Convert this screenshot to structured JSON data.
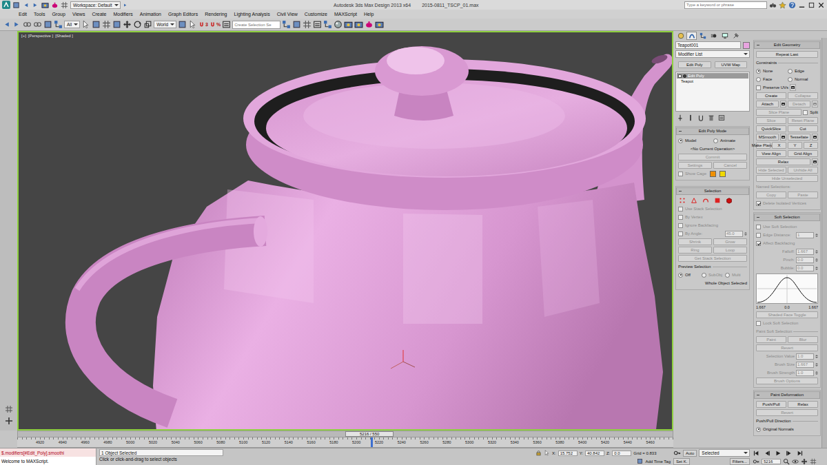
{
  "title_bar": {
    "workspace": "Workspace: Default",
    "title": "Autodesk 3ds Max Design 2013 x64",
    "file": "2015-0811_TSCP_01.max",
    "search": {
      "placeholder": "Type a keyword or phrase"
    }
  },
  "menu": [
    "Edit",
    "Tools",
    "Group",
    "Views",
    "Create",
    "Modifiers",
    "Animation",
    "Graph Editors",
    "Rendering",
    "Lighting Analysis",
    "Civil View",
    "Customize",
    "MAXScript",
    "Help"
  ],
  "toolbar": {
    "selection_filter": "All",
    "reference_coord": "World",
    "snaps": [
      "3",
      "%"
    ],
    "named_selection": {
      "placeholder": "Create Selection Se"
    }
  },
  "viewport": {
    "labels": [
      "[+]",
      "[Perspective ]",
      "[Shaded ]"
    ],
    "active": true
  },
  "command_panel": {
    "tabs": [
      {
        "selected": false
      },
      {
        "selected": true
      },
      {
        "selected": false
      },
      {
        "selected": false
      },
      {
        "selected": false
      },
      {
        "selected": false
      }
    ],
    "object_name": "Teapot001",
    "object_color": "#e8a4e0",
    "modifier_list": "Modifier List",
    "modifier_buttons": [
      "Edit Poly",
      "UVW Map"
    ],
    "stack": [
      {
        "label": "Edit Poly",
        "selected": true
      },
      {
        "label": "Teapot",
        "selected": false
      }
    ],
    "left_rollouts": [
      {
        "title": "Edit Poly Mode",
        "expanded": true,
        "rows": [
          [
            {
              "kind": "radio",
              "label": "Model",
              "selected": true,
              "disabled": false
            },
            {
              "kind": "radio",
              "label": "Animate",
              "selected": false,
              "disabled": false
            }
          ],
          [
            {
              "kind": "caption",
              "label": "<No Current Operation>",
              "disabled": false
            }
          ],
          [
            {
              "kind": "button",
              "label": "Commit",
              "disabled": true
            }
          ],
          [
            {
              "kind": "button",
              "label": "Settings",
              "disabled": true
            },
            {
              "kind": "button",
              "label": "Cancel",
              "disabled": true
            }
          ],
          [
            {
              "kind": "check",
              "label": "Show Cage",
              "checked": false,
              "disabled": true
            },
            {
              "kind": "swatch",
              "color": "#f09000"
            },
            {
              "kind": "swatch",
              "color": "#f0d800"
            }
          ]
        ]
      },
      {
        "title": "Selection",
        "expanded": true,
        "rows": [
          [
            {
              "kind": "subobj",
              "selected": false
            },
            {
              "kind": "subobj",
              "selected": false
            },
            {
              "kind": "subobj",
              "selected": false
            },
            {
              "kind": "subobj",
              "selected": false
            },
            {
              "kind": "subobj",
              "selected": false
            }
          ],
          [
            {
              "kind": "check",
              "label": "Use Stack Selection",
              "checked": false,
              "disabled": true
            }
          ],
          [
            {
              "kind": "check",
              "label": "By Vertex",
              "checked": false,
              "disabled": true
            }
          ],
          [
            {
              "kind": "check",
              "label": "Ignore Backfacing",
              "checked": false,
              "disabled": true
            }
          ],
          [
            {
              "kind": "check",
              "label": "By Angle:",
              "checked": false,
              "disabled": true
            },
            {
              "kind": "spinner",
              "value": "45.0",
              "disabled": true
            }
          ],
          [
            {
              "kind": "button",
              "label": "Shrink",
              "disabled": true
            },
            {
              "kind": "button",
              "label": "Grow",
              "disabled": true
            }
          ],
          [
            {
              "kind": "button",
              "label": "Ring",
              "disabled": true
            },
            {
              "kind": "button",
              "label": "Loop",
              "disabled": true
            }
          ],
          [
            {
              "kind": "button",
              "label": "Get Stack Selection",
              "disabled": true
            }
          ],
          [
            {
              "kind": "group",
              "label": "Preview Selection",
              "disabled": false
            }
          ],
          [
            {
              "kind": "radio",
              "label": "Off",
              "selected": true,
              "disabled": false
            },
            {
              "kind": "radio",
              "label": "SubObj",
              "selected": false,
              "disabled": true
            },
            {
              "kind": "radio",
              "label": "Multi",
              "selected": false,
              "disabled": true
            }
          ],
          [
            {
              "kind": "note",
              "label": "Whole Object Selected",
              "disabled": false
            }
          ]
        ]
      }
    ],
    "right_rollouts": [
      {
        "title": "Edit Geometry",
        "expanded": true,
        "rows": [
          [
            {
              "kind": "button",
              "label": "Repeat Last",
              "disabled": false
            }
          ],
          [
            {
              "kind": "group",
              "label": "Constraints",
              "disabled": false
            }
          ],
          [
            {
              "kind": "radio",
              "label": "None",
              "selected": true,
              "disabled": false
            },
            {
              "kind": "radio",
              "label": "Edge",
              "selected": false,
              "disabled": false
            }
          ],
          [
            {
              "kind": "radio",
              "label": "Face",
              "selected": false,
              "disabled": false
            },
            {
              "kind": "radio",
              "label": "Normal",
              "selected": false,
              "disabled": false
            }
          ],
          [
            {
              "kind": "check",
              "label": "Preserve UVs",
              "checked": false,
              "disabled": false
            },
            {
              "kind": "settings",
              "disabled": false
            }
          ],
          [
            {
              "kind": "button",
              "label": "Create",
              "disabled": false
            },
            {
              "kind": "button",
              "label": "Collapse",
              "disabled": true
            }
          ],
          [
            {
              "kind": "button",
              "label": "Attach",
              "disabled": false
            },
            {
              "kind": "settings",
              "disabled": false
            },
            {
              "kind": "button",
              "label": "Detach",
              "disabled": true
            },
            {
              "kind": "settings",
              "disabled": true
            }
          ],
          [
            {
              "kind": "button",
              "label": "Slice Plane",
              "disabled": true
            },
            {
              "kind": "check",
              "label": "Split",
              "checked": false,
              "disabled": false
            }
          ],
          [
            {
              "kind": "button",
              "label": "Slice",
              "disabled": true
            },
            {
              "kind": "button",
              "label": "Reset Plane",
              "disabled": true
            }
          ],
          [
            {
              "kind": "button",
              "label": "QuickSlice",
              "disabled": false
            },
            {
              "kind": "button",
              "label": "Cut",
              "disabled": false
            }
          ],
          [
            {
              "kind": "button",
              "label": "MSmooth",
              "disabled": false
            },
            {
              "kind": "settings",
              "disabled": false
            },
            {
              "kind": "button",
              "label": "Tessellate",
              "disabled": false
            },
            {
              "kind": "settings",
              "disabled": false
            }
          ],
          [
            {
              "kind": "button",
              "label": "Make Planar",
              "disabled": false
            },
            {
              "kind": "button",
              "label": "X",
              "disabled": false
            },
            {
              "kind": "button",
              "label": "Y",
              "disabled": false
            },
            {
              "kind": "button",
              "label": "Z",
              "disabled": false
            }
          ],
          [
            {
              "kind": "button",
              "label": "View Align",
              "disabled": false
            },
            {
              "kind": "button",
              "label": "Grid Align",
              "disabled": false
            }
          ],
          [
            {
              "kind": "button",
              "label": "Relax",
              "disabled": false
            },
            {
              "kind": "settings",
              "disabled": false
            }
          ],
          [
            {
              "kind": "button",
              "label": "Hide Selected",
              "disabled": true
            },
            {
              "kind": "button",
              "label": "Unhide All",
              "disabled": true
            }
          ],
          [
            {
              "kind": "button",
              "label": "Hide Unselected",
              "disabled": true
            }
          ],
          [
            {
              "kind": "label",
              "label": "Named Selections:",
              "disabled": true
            }
          ],
          [
            {
              "kind": "button",
              "label": "Copy",
              "disabled": true
            },
            {
              "kind": "button",
              "label": "Paste",
              "disabled": true
            }
          ],
          [
            {
              "kind": "check",
              "label": "Delete Isolated Vertices",
              "checked": true,
              "disabled": true
            }
          ]
        ]
      },
      {
        "title": "Soft Selection",
        "expanded": true,
        "rows": [
          [
            {
              "kind": "check",
              "label": "Use Soft Selection",
              "checked": false,
              "disabled": true
            }
          ],
          [
            {
              "kind": "check",
              "label": "Edge Distance:",
              "checked": false,
              "disabled": true
            },
            {
              "kind": "spinner",
              "value": "1",
              "disabled": true
            }
          ],
          [
            {
              "kind": "check",
              "label": "Affect Backfacing",
              "checked": true,
              "disabled": true
            }
          ],
          [
            {
              "kind": "spinner",
              "label": "Falloff:",
              "value": "1.667",
              "disabled": true
            }
          ],
          [
            {
              "kind": "spinner",
              "label": "Pinch:",
              "value": "0.0",
              "disabled": true
            }
          ],
          [
            {
              "kind": "spinner",
              "label": "Bubble:",
              "value": "0.0",
              "disabled": true
            }
          ],
          [
            {
              "kind": "curve",
              "labels": [
                "1.667",
                "0.0",
                "1.667"
              ],
              "disabled": false
            }
          ],
          [
            {
              "kind": "button",
              "label": "Shaded Face Toggle",
              "disabled": true
            }
          ],
          [
            {
              "kind": "check",
              "label": "Lock Soft Selection",
              "checked": false,
              "disabled": true
            }
          ],
          [
            {
              "kind": "group",
              "label": "Paint Soft Selection",
              "disabled": true
            }
          ],
          [
            {
              "kind": "button",
              "label": "Paint",
              "disabled": true
            },
            {
              "kind": "button",
              "label": "Blur",
              "disabled": true
            }
          ],
          [
            {
              "kind": "button",
              "label": "Revert",
              "disabled": true
            }
          ],
          [
            {
              "kind": "spinner",
              "label": "Selection Value",
              "value": "1.0",
              "disabled": true
            }
          ],
          [
            {
              "kind": "spinner",
              "label": "Brush Size",
              "value": "1.667",
              "disabled": true
            }
          ],
          [
            {
              "kind": "spinner",
              "label": "Brush Strength",
              "value": "1.0",
              "disabled": true
            }
          ],
          [
            {
              "kind": "button",
              "label": "Brush Options",
              "disabled": true
            }
          ]
        ]
      },
      {
        "title": "Paint Deformation",
        "expanded": true,
        "rows": [
          [
            {
              "kind": "button",
              "label": "Push/Pull",
              "disabled": false
            },
            {
              "kind": "button",
              "label": "Relax",
              "disabled": false
            }
          ],
          [
            {
              "kind": "button",
              "label": "Revert",
              "disabled": true
            }
          ],
          [
            {
              "kind": "group",
              "label": "Push/Pull Direction",
              "disabled": false
            }
          ],
          [
            {
              "kind": "radio",
              "label": "Original Normals",
              "selected": true,
              "disabled": false
            }
          ]
        ]
      }
    ]
  },
  "time_slider": {
    "label": "5216 / 550",
    "level": 0.54
  },
  "track_bar": {
    "ticks": [
      "4920",
      "4940",
      "4960",
      "4980",
      "5000",
      "5020",
      "5040",
      "5060",
      "5080",
      "5100",
      "5120",
      "5140",
      "5160",
      "5180",
      "5200",
      "5220",
      "5240",
      "5260",
      "5280",
      "5300",
      "5320",
      "5340",
      "5360",
      "5380",
      "5400",
      "5420",
      "5440",
      "5460"
    ]
  },
  "status_bar": {
    "maxscript": [
      "$.modifiers[#Edit_Poly].smoothi",
      "Welcome to MAXScript."
    ],
    "selection": "1 Object Selected",
    "prompt": "Click or click-and-drag to select objects",
    "coords": [
      {
        "label": "X:",
        "value": "15.752"
      },
      {
        "label": "Y:",
        "value": "40.842"
      },
      {
        "label": "Z:",
        "value": "0.0"
      }
    ],
    "grid": "Grid = 0.833",
    "time_tag": "Add Time Tag",
    "auto_key": {
      "label": "Auto",
      "on": false
    },
    "key_filter": "Selected",
    "set_key": "Set K.",
    "filters": "Filters...",
    "frame": "5216"
  }
}
